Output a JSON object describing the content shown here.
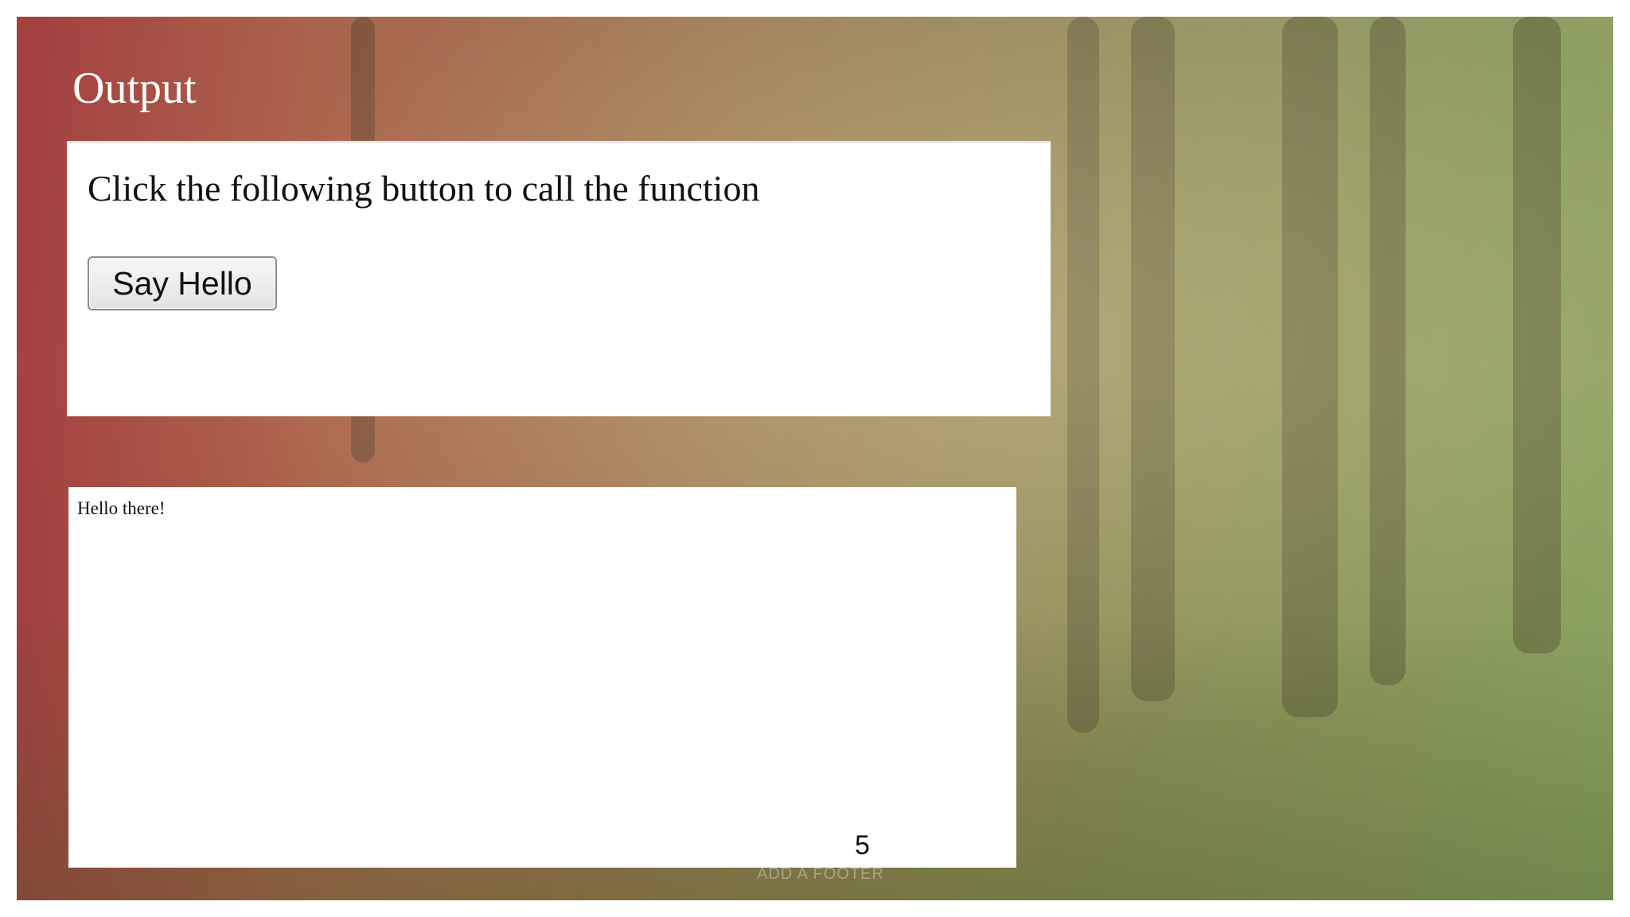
{
  "slide": {
    "title": "Output",
    "page_number": "5",
    "footer": "ADD A FOOTER"
  },
  "demo": {
    "prompt": "Click the following button to call the function",
    "button_label": "Say Hello"
  },
  "result": {
    "message": "Hello there!"
  }
}
